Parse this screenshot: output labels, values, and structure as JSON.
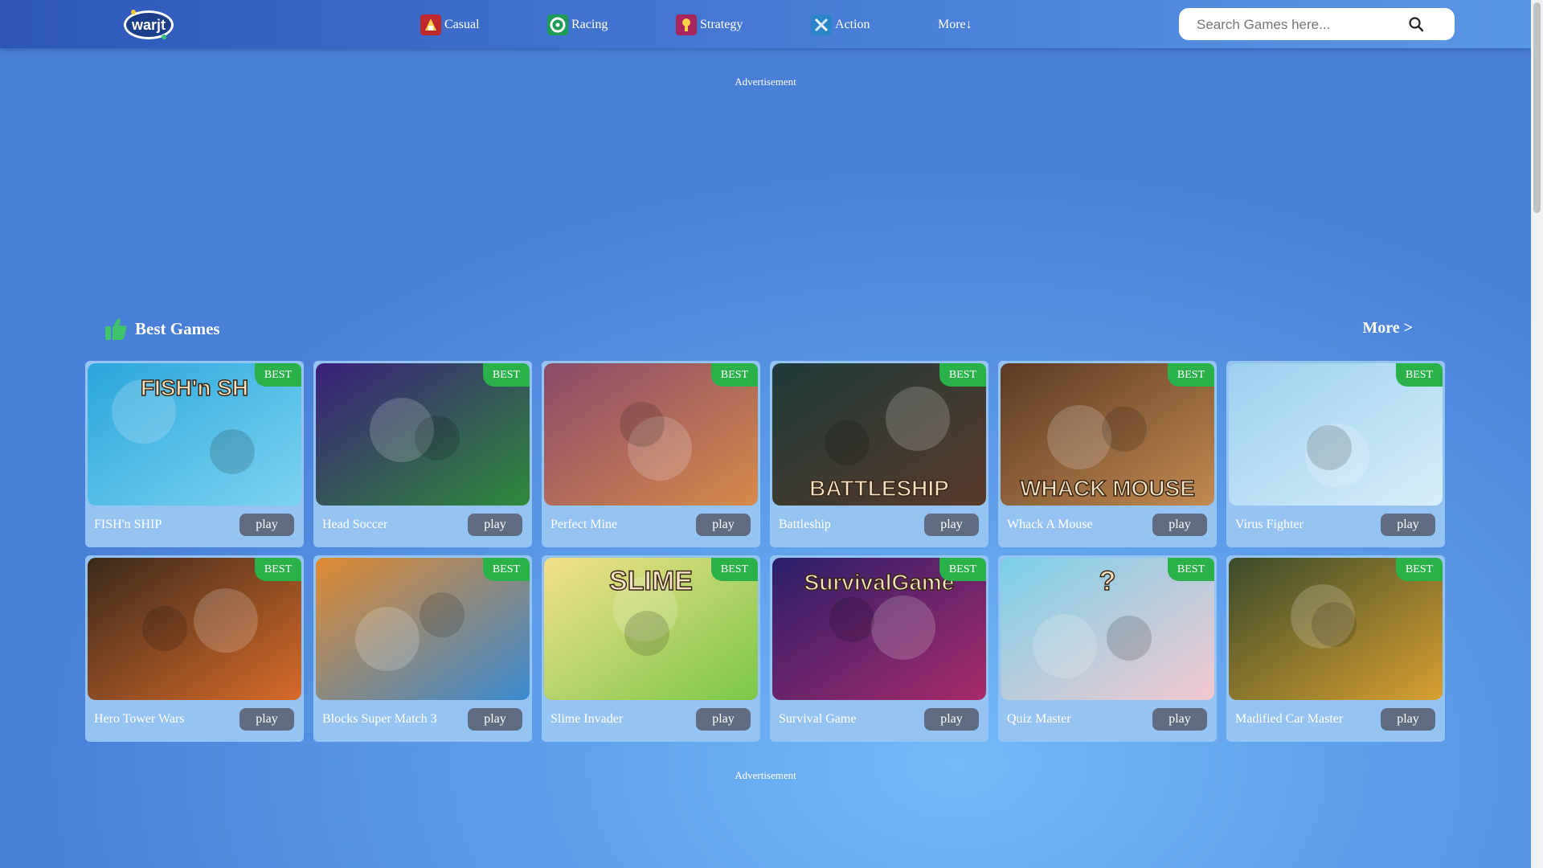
{
  "header": {
    "logo_text": "warjt",
    "nav": [
      {
        "label": "Casual",
        "icon": "casual-icon",
        "color": "#c0272d"
      },
      {
        "label": "Racing",
        "icon": "racing-icon",
        "color": "#1e9a57"
      },
      {
        "label": "Strategy",
        "icon": "strategy-icon",
        "color": "#a8255e"
      },
      {
        "label": "Action",
        "icon": "action-icon",
        "color": "#2c84c8"
      },
      {
        "label": "More↓"
      }
    ],
    "search": {
      "placeholder": "Search Games here..."
    }
  },
  "ads": {
    "top_label": "Advertisement",
    "bottom_label": "Advertisement"
  },
  "section": {
    "title": "Best Games",
    "more_label": "More >",
    "badge_label": "BEST",
    "play_label": "play",
    "games": [
      {
        "name": "FISH'n SHIP",
        "thumb_text": "FISH'n SH",
        "thumb_colors": [
          "#2aa6dc",
          "#7dd4f0"
        ]
      },
      {
        "name": "Head Soccer",
        "thumb_text": "",
        "thumb_colors": [
          "#3a1f7a",
          "#2f8a3a"
        ]
      },
      {
        "name": "Perfect Mine",
        "thumb_text": "",
        "thumb_colors": [
          "#8a4a6a",
          "#d68a4a"
        ]
      },
      {
        "name": "Battleship",
        "thumb_text": "BATTLESHIP",
        "thumb_colors": [
          "#1d3a38",
          "#5a3a2a"
        ]
      },
      {
        "name": "Whack A Mouse",
        "thumb_text": "WHACK MOUSE",
        "thumb_colors": [
          "#5a3a22",
          "#c28a52"
        ]
      },
      {
        "name": "Virus Fighter",
        "thumb_text": "",
        "thumb_colors": [
          "#9ad0ee",
          "#d8eefa"
        ]
      },
      {
        "name": "Hero Tower Wars",
        "thumb_text": "",
        "thumb_colors": [
          "#3a2a1a",
          "#d86a2a"
        ]
      },
      {
        "name": "Blocks Super Match 3",
        "thumb_text": "",
        "thumb_colors": [
          "#e08a30",
          "#3a8ad0"
        ]
      },
      {
        "name": "Slime Invader",
        "thumb_text": "SLIME",
        "thumb_colors": [
          "#f4e08a",
          "#7ac84a"
        ]
      },
      {
        "name": "Survival Game",
        "thumb_text": "SurvivalGame",
        "thumb_colors": [
          "#2a1f6a",
          "#a82a6a"
        ]
      },
      {
        "name": "Quiz Master",
        "thumb_text": "?",
        "thumb_colors": [
          "#7ad0e8",
          "#f4c8d0"
        ]
      },
      {
        "name": "Madified Car Master",
        "thumb_text": "",
        "thumb_colors": [
          "#3a4a2a",
          "#d8a030"
        ]
      }
    ]
  }
}
